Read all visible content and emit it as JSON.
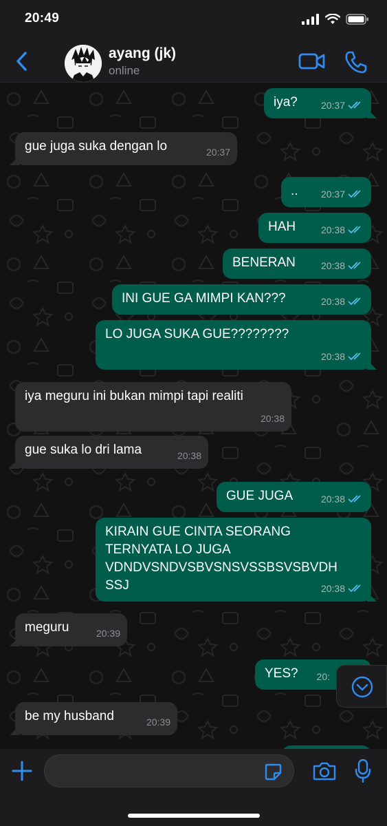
{
  "status_bar": {
    "time": "20:49"
  },
  "header": {
    "contact_name": "ayang (jk)",
    "contact_status": "online",
    "icons": [
      "back-chevron-icon",
      "video-call-icon",
      "phone-call-icon"
    ]
  },
  "messages": [
    {
      "direction": "out",
      "text": "iya?",
      "time": "20:37",
      "read": true
    },
    {
      "direction": "in",
      "text": "gue juga suka dengan lo",
      "time": "20:37"
    },
    {
      "direction": "out",
      "text": "..",
      "time": "20:37",
      "read": true
    },
    {
      "direction": "out",
      "text": "HAH",
      "time": "20:38",
      "read": true
    },
    {
      "direction": "out",
      "text": "BENERAN",
      "time": "20:38",
      "read": true
    },
    {
      "direction": "out",
      "text": "INI GUE GA MIMPI KAN???",
      "time": "20:38",
      "read": true
    },
    {
      "direction": "out",
      "text": "LO JUGA SUKA GUE????????",
      "time": "20:38",
      "read": true
    },
    {
      "direction": "in",
      "text": "iya meguru ini bukan mimpi tapi realiti",
      "time": "20:38"
    },
    {
      "direction": "in",
      "text": "gue suka lo dri lama",
      "time": "20:38"
    },
    {
      "direction": "out",
      "text": "GUE JUGA",
      "time": "20:38",
      "read": true
    },
    {
      "direction": "out",
      "text": "KIRAIN GUE CINTA SEORANG\nTERNYATA LO JUGA\nVDNDVSNDVSBVSNSVSSBSVSBVDH\nSSJ",
      "time": "20:38",
      "read": true
    },
    {
      "direction": "in",
      "text": "meguru",
      "time": "20:39"
    },
    {
      "direction": "out",
      "text": "YES?",
      "time": "20:",
      "read": true
    },
    {
      "direction": "in",
      "text": "be my husband",
      "time": "20:39"
    }
  ],
  "input_bar": {
    "placeholder": "",
    "icons": [
      "plus-icon",
      "sticker-icon",
      "camera-icon",
      "microphone-icon"
    ]
  },
  "colors": {
    "outgoing_bubble": "#005c4b",
    "incoming_bubble": "#2c2c2e",
    "accent": "#2f8cf0",
    "read_tick": "#53bdeb"
  }
}
